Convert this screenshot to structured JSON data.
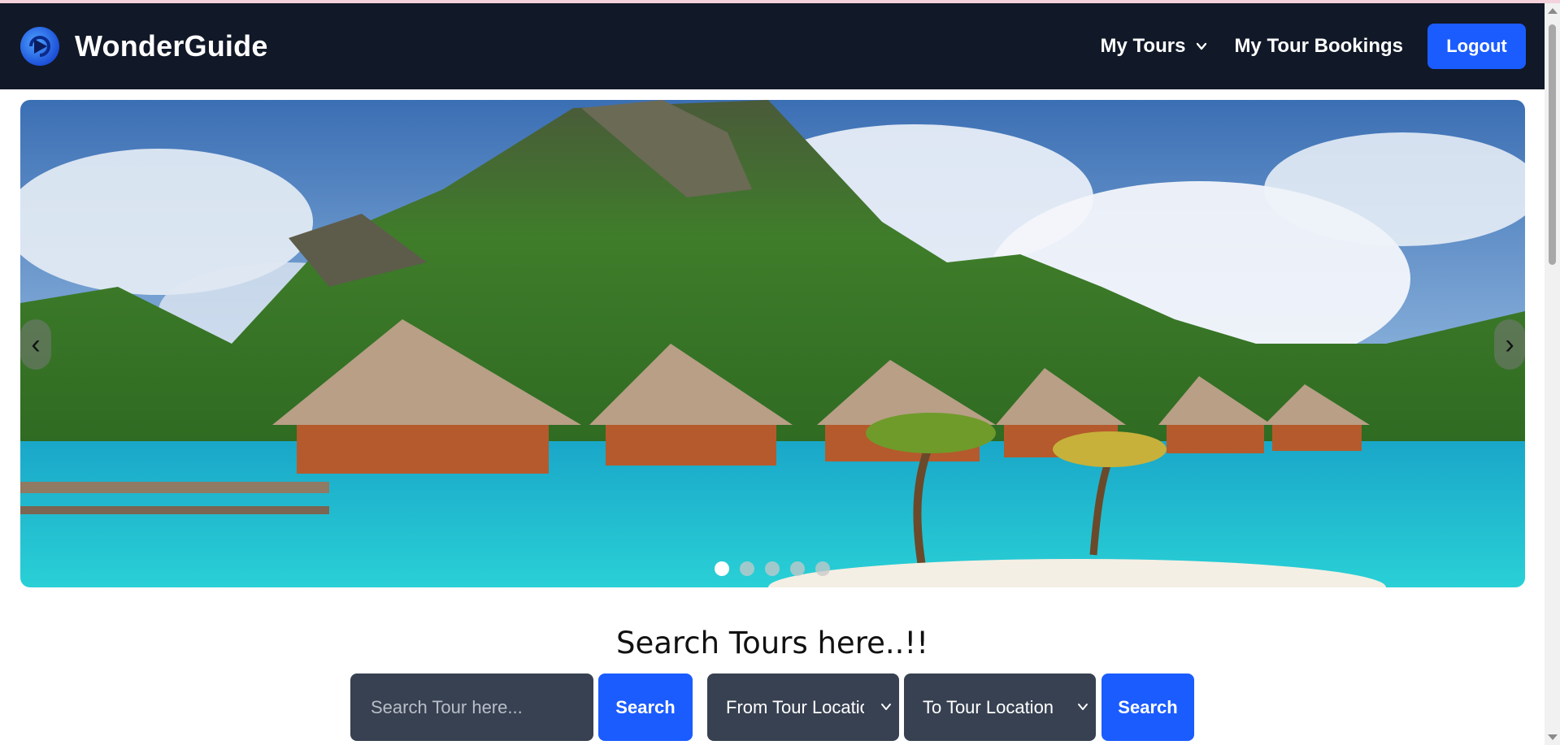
{
  "app": {
    "brand_name": "WonderGuide",
    "logo_icon": "wonderguide-logo-icon",
    "accent_color": "#1b5cff",
    "navbar_color": "#111827"
  },
  "nav": {
    "my_tours": "My Tours",
    "my_tours_icon": "chevron-down-icon",
    "my_tour_bookings": "My Tour Bookings",
    "logout": "Logout"
  },
  "carousel": {
    "prev_label": "‹",
    "next_label": "›",
    "slide_count": 5,
    "active_index": 0
  },
  "search": {
    "heading": "Search Tours here..!!",
    "input_placeholder": "Search Tour here...",
    "search_button_label": "Search",
    "from_location": "From Tour Location",
    "to_location": "To Tour Location",
    "location_search_button_label": "Search"
  }
}
